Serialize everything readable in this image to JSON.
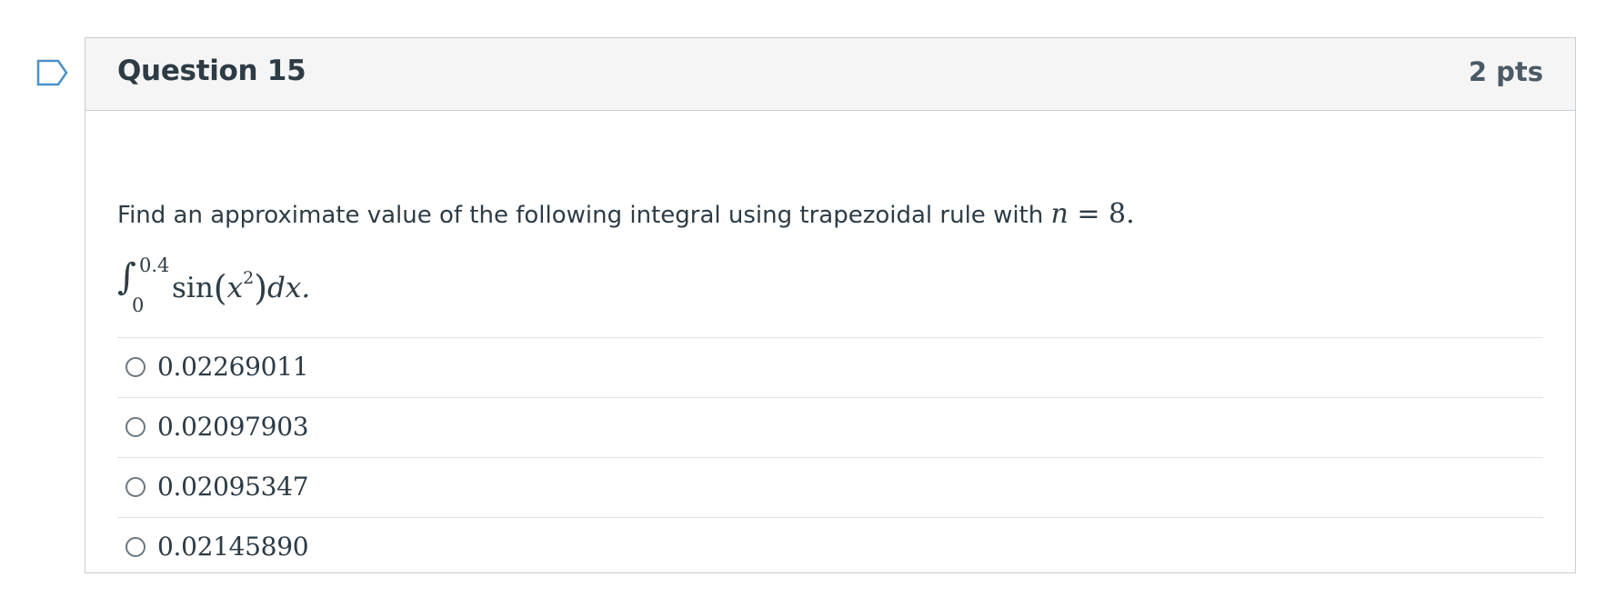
{
  "question": {
    "title": "Question 15",
    "points": "2 pts",
    "prompt_text": "Find an approximate value of the following integral using trapezoidal rule with ",
    "prompt_math_var": "n",
    "prompt_math_rest": " = 8.",
    "integral": {
      "upper": "0.4",
      "lower": "0",
      "integrand_func": "sin",
      "integrand_var": "x",
      "integrand_exp": "2",
      "differential": "dx."
    }
  },
  "answers": [
    {
      "label": "0.02269011"
    },
    {
      "label": "0.02097903"
    },
    {
      "label": "0.02095347"
    },
    {
      "label": "0.02145890"
    }
  ],
  "icons": {
    "flag": "bookmark-flag-icon",
    "radio": "radio-unchecked-icon"
  }
}
